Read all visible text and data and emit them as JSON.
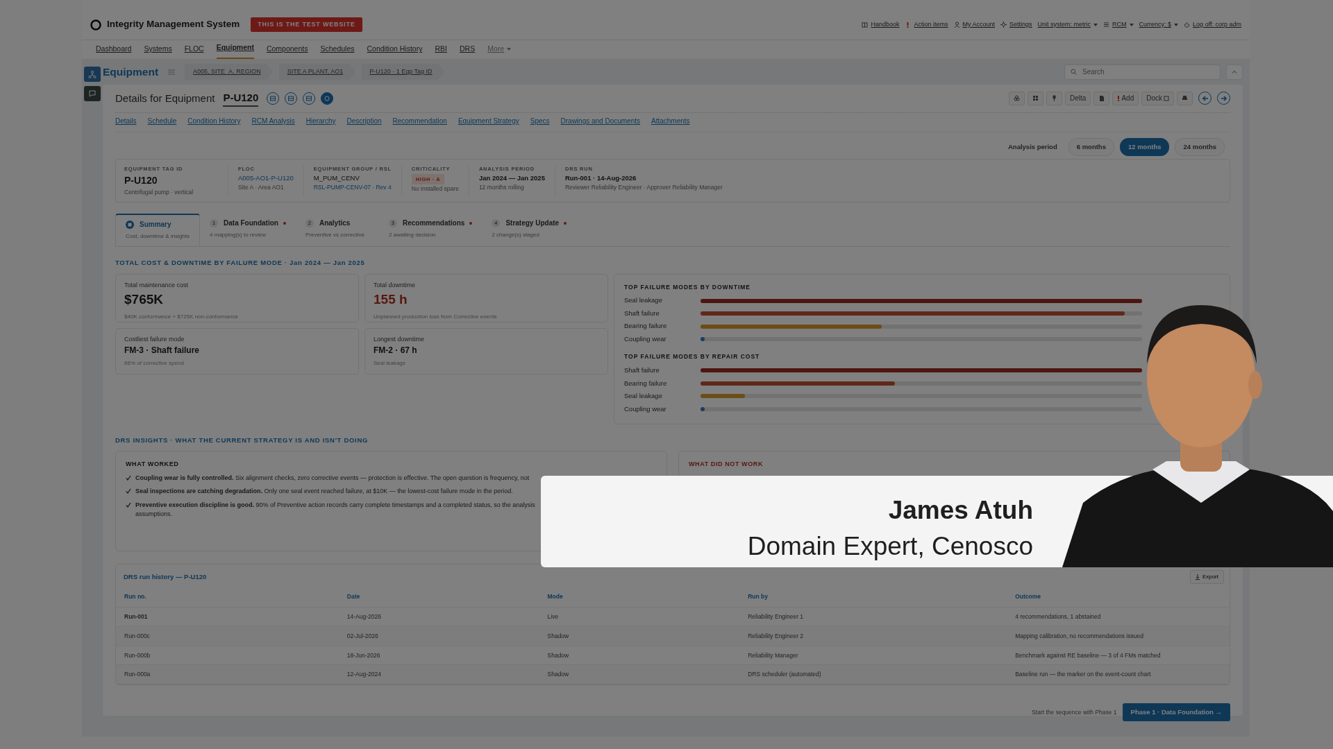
{
  "header": {
    "title": "Integrity Management System",
    "test_badge": "THIS IS THE TEST WEBSITE",
    "links": [
      {
        "label": "Handbook"
      },
      {
        "label": "Action items"
      },
      {
        "label": "My Account"
      },
      {
        "label": "Settings"
      },
      {
        "label": "Unit system: metric"
      },
      {
        "label": "RCM"
      },
      {
        "label": "Currency: $"
      },
      {
        "label": "Log off: corp adm"
      }
    ],
    "nav": [
      {
        "label": "Dashboard",
        "selected": false
      },
      {
        "label": "Systems",
        "selected": false
      },
      {
        "label": "FLOC",
        "selected": false
      },
      {
        "label": "Equipment",
        "selected": true
      },
      {
        "label": "Components",
        "selected": false
      },
      {
        "label": "Schedules",
        "selected": false
      },
      {
        "label": "Condition History",
        "selected": false
      },
      {
        "label": "RBI",
        "selected": false
      },
      {
        "label": "DRS",
        "selected": false
      },
      {
        "label": "More",
        "selected": false
      }
    ]
  },
  "equipment": {
    "title": "Equipment",
    "breadcrumbs": [
      "A005, SITE_A, REGION",
      "SITE A PLANT, AO1",
      "P-U120 · 1 Eqp Tag ID"
    ],
    "search": {
      "placeholder": "Search"
    }
  },
  "details": {
    "label": "Details for Equipment",
    "tag": "P-U120",
    "toolbar": [
      "Delta",
      "Add",
      "Dock"
    ],
    "tabs": [
      "Details",
      "Schedule",
      "Condition History",
      "RCM Analysis",
      "Hierarchy",
      "Description",
      "Recommendation",
      "Equipment Strategy",
      "Specs",
      "Drawings and Documents",
      "Attachments"
    ]
  },
  "analysis_period": {
    "label": "Analysis period",
    "options": [
      {
        "label": "6 months",
        "selected": false
      },
      {
        "label": "12 months",
        "selected": true
      },
      {
        "label": "24 months",
        "selected": false
      }
    ]
  },
  "info": [
    {
      "label": "EQUIPMENT TAG ID",
      "value": "P-U120",
      "sub": "Centrifugal pump · vertical",
      "kind": "big"
    },
    {
      "label": "FLOC",
      "value": "A005-AO1-P-U120",
      "sub": "Site A · Area AO1",
      "kind": "link"
    },
    {
      "label": "EQUIPMENT GROUP / RSL",
      "value": "M_PUM_CENV",
      "sub": "RSL-PUMP-CENV-07 · Rev 4",
      "kind": "sublink"
    },
    {
      "label": "CRITICALITY",
      "value": "HIGH · A",
      "sub": "No installed spare",
      "kind": "badge"
    },
    {
      "label": "ANALYSIS PERIOD",
      "value": "Jan 2024 — Jan 2025",
      "sub": "12 months rolling",
      "kind": "bold"
    },
    {
      "label": "DRS RUN",
      "value": "Run-001 · 14-Aug-2026",
      "sub": "Reviewer Reliability Engineer · Approver Reliability Manager",
      "kind": "bold"
    }
  ],
  "steps": [
    {
      "title": "Summary",
      "subtitle": "Cost, downtime & insights",
      "selected": true,
      "pending": false
    },
    {
      "number": "1",
      "title": "Data Foundation",
      "subtitle": "4 mapping(s) to review",
      "selected": false,
      "pending": true
    },
    {
      "number": "2",
      "title": "Analytics",
      "subtitle": "Preventive vs corrective",
      "selected": false,
      "pending": false
    },
    {
      "number": "3",
      "title": "Recommendations",
      "subtitle": "2 awaiting decision",
      "selected": false,
      "pending": true
    },
    {
      "number": "4",
      "title": "Strategy Update",
      "subtitle": "2 change(s) staged",
      "selected": false,
      "pending": true
    }
  ],
  "cost_section": {
    "title": "TOTAL COST & DOWNTIME BY FAILURE MODE · Jan 2024 — Jan 2025",
    "metrics": [
      {
        "label": "Total maintenance cost",
        "value": "$765K",
        "sub": "$40K conformance + $725K non-conformance",
        "kind": "big"
      },
      {
        "label": "Total downtime",
        "value": "155 h",
        "sub": "Unplanned production loss from Corrective events",
        "kind": "alert"
      },
      {
        "label": "Costliest failure mode",
        "value": "FM-3 · Shaft failure",
        "sub": "66% of corrective spend",
        "kind": "medium"
      },
      {
        "label": "Longest downtime",
        "value": "FM-2 · 67 h",
        "sub": "Seal leakage",
        "kind": "medium"
      }
    ],
    "groups": [
      {
        "title": "TOP FAILURE MODES BY DOWNTIME",
        "items": [
          {
            "label": "Seal leakage",
            "level": 1.0
          },
          {
            "label": "Shaft failure",
            "level": 0.96
          },
          {
            "label": "Bearing failure",
            "level": 0.41
          },
          {
            "label": "Coupling wear",
            "level": 0.01
          }
        ]
      },
      {
        "title": "TOP FAILURE MODES BY REPAIR COST",
        "items": [
          {
            "label": "Shaft failure",
            "level": 1.0
          },
          {
            "label": "Bearing failure",
            "level": 0.44
          },
          {
            "label": "Seal leakage",
            "level": 0.1
          },
          {
            "label": "Coupling wear",
            "level": 0.01
          }
        ]
      }
    ]
  },
  "insights": {
    "title": "DRS INSIGHTS · WHAT THE CURRENT STRATEGY IS AND ISN'T DOING",
    "worked": {
      "title": "WHAT WORKED",
      "items": [
        {
          "text": "**Coupling wear is fully controlled.** Six alignment checks, zero corrective events — protection is effective. The open question is frequency, not"
        },
        {
          "text": "**Seal inspections are catching degradation.** Only one seal event reached failure, at $10K — the lowest-cost failure mode in the period."
        },
        {
          "text": "**Preventive execution discipline is good.** 90% of Preventive action records carry complete timestamps and a completed status, so the analysis",
          "more": "assumptions."
        }
      ]
    },
    "not_worked": {
      "title": "WHAT DID NOT WORK"
    }
  },
  "runs": {
    "title": "DRS run history — P-U120",
    "export": "Export",
    "columns": [
      "Run no.",
      "Date",
      "Mode",
      "Run by",
      "Outcome"
    ],
    "rows": [
      {
        "current": true,
        "cells": [
          "Run-001",
          "14-Aug-2026",
          "Live",
          "Reliability Engineer 1",
          "4 recommendations, 1 abstained"
        ]
      },
      {
        "current": false,
        "cells": [
          "Run-000c",
          "02-Jul-2026",
          "Shadow",
          "Reliability Engineer 2",
          "Mapping calibration, no recommendations issued"
        ]
      },
      {
        "current": false,
        "cells": [
          "Run-000b",
          "18-Jun-2026",
          "Shadow",
          "Reliability Manager",
          "Benchmark against RE baseline — 3 of 4 FMs matched"
        ]
      },
      {
        "current": false,
        "cells": [
          "Run-000a",
          "12-Aug-2024",
          "Shadow",
          "DRS scheduler (automated)",
          "Baseline run — the marker on the event-count chart"
        ]
      }
    ]
  },
  "footer": {
    "hint": "Start the sequence with Phase 1",
    "button": "Phase 1 · Data Foundation →"
  },
  "lower_third": {
    "name": "James Atuh",
    "role": "Domain Expert, Cenosco"
  }
}
